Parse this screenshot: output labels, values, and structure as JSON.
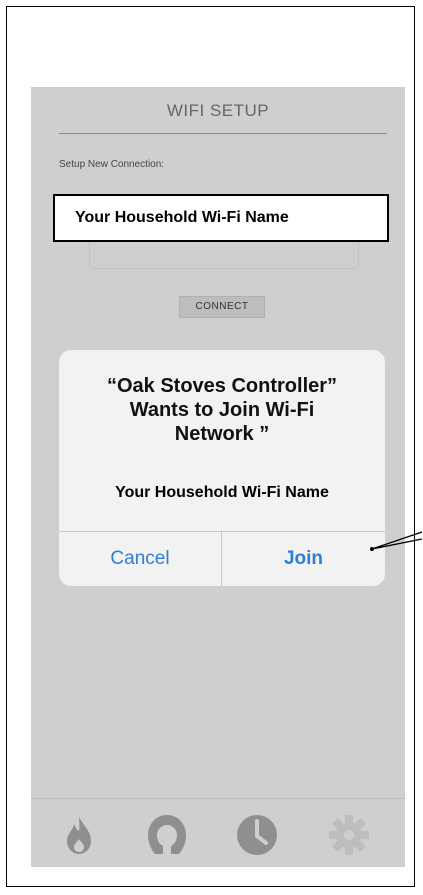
{
  "screen": {
    "title": "WIFI SETUP",
    "setup_label": "Setup New Connection:",
    "ssid_value": "Your Household Wi-Fi Name",
    "connect_label": "CONNECT"
  },
  "alert": {
    "title_line1": "“Oak  Stoves  Controller”",
    "title_line2": "Wants to Join Wi-Fi",
    "title_line3": "Network ”",
    "network_name": "Your Household Wi-Fi Name",
    "cancel_label": "Cancel",
    "join_label": "Join"
  },
  "tabbar": {
    "tabs": [
      {
        "icon": "flame-icon"
      },
      {
        "icon": "user-icon"
      },
      {
        "icon": "clock-icon"
      },
      {
        "icon": "gear-icon"
      }
    ]
  },
  "colors": {
    "screen_bg": "#cfcfcf",
    "alert_bg": "#f2f2f2",
    "ios_blue": "#2f7ed6",
    "icon_gray": "#8f8f8f"
  }
}
